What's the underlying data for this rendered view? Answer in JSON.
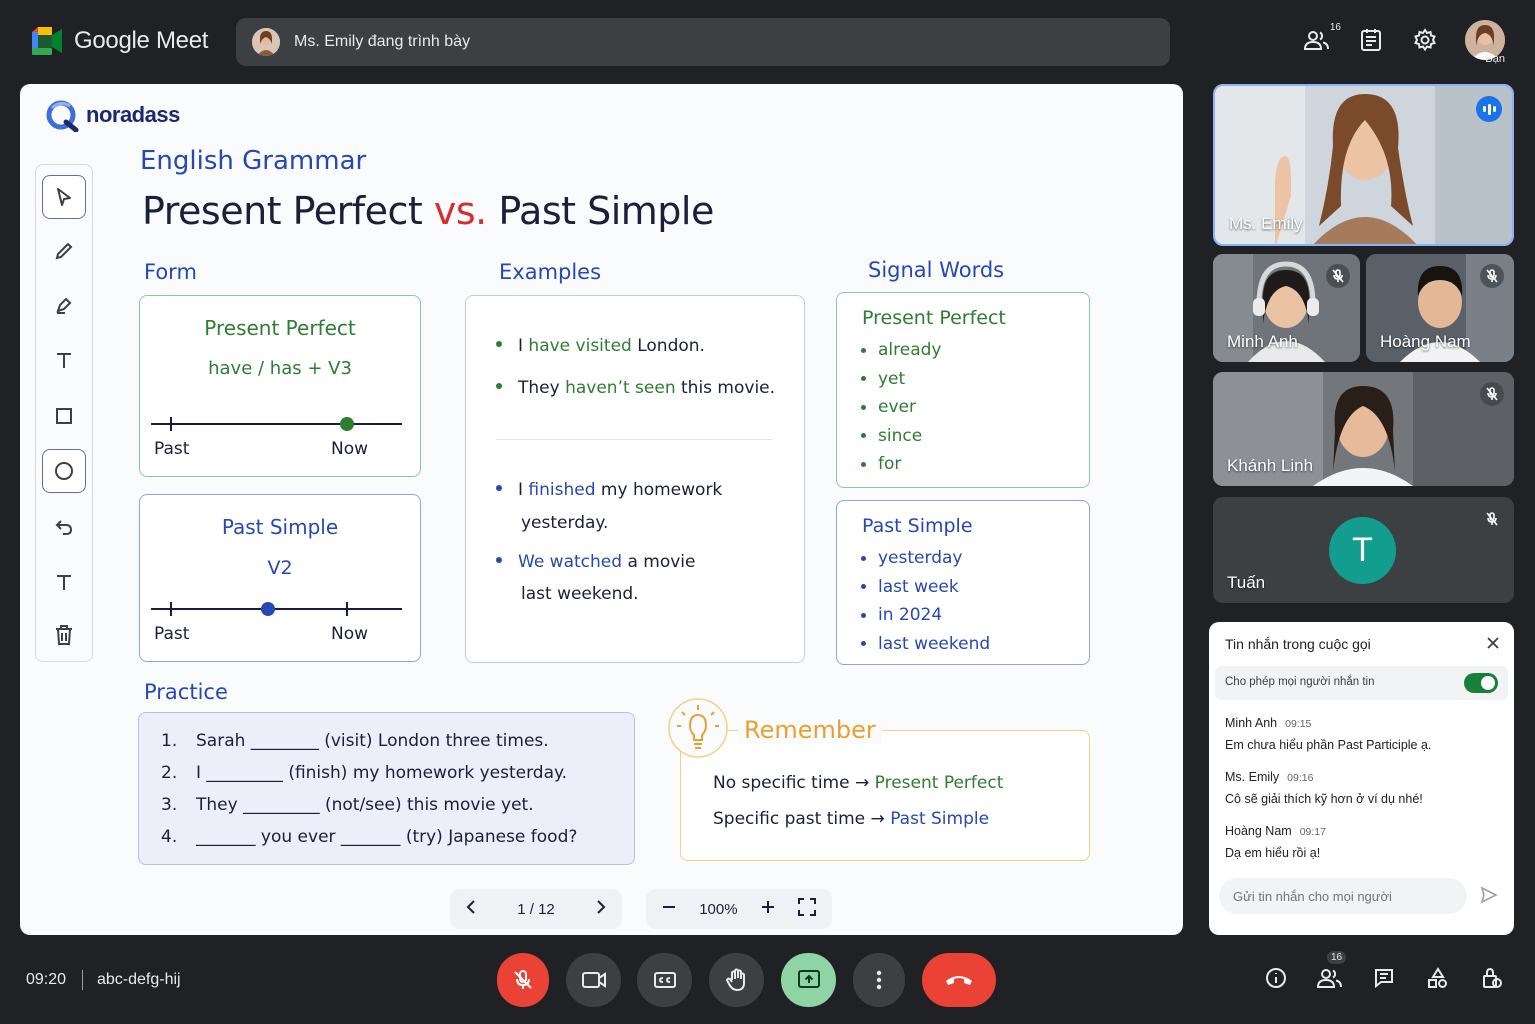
{
  "app": {
    "name": "Google Meet",
    "presenting": "Ms. Emily đang trình bày",
    "participant_count": "16",
    "me_label": "Bạn"
  },
  "slide": {
    "brand": "noradass",
    "subtitle": "English Grammar",
    "title_a": "Present Perfect",
    "title_vs": "vs.",
    "title_b": "Past Simple",
    "form": {
      "heading": "Form",
      "pp_title": "Present Perfect",
      "pp_formula": "have / has + V3",
      "ps_title": "Past Simple",
      "ps_formula": "V2",
      "past": "Past",
      "now": "Now"
    },
    "examples": {
      "heading": "Examples",
      "pp": [
        {
          "a": "I ",
          "b": "have visited",
          "c": " London."
        },
        {
          "a": "They ",
          "b": "haven’t seen",
          "c": " this movie."
        }
      ],
      "ps": [
        {
          "a": "I ",
          "b": "finished",
          "c": " my homework",
          "d": "yesterday."
        },
        {
          "a": "",
          "b": "We watched",
          "c": " a movie",
          "d": "last weekend."
        }
      ]
    },
    "signal": {
      "heading": "Signal Words",
      "pp_title": "Present Perfect",
      "pp_words": [
        "already",
        "yet",
        "ever",
        "since",
        "for"
      ],
      "ps_title": "Past Simple",
      "ps_words": [
        "yesterday",
        "last week",
        "in 2024",
        "last weekend"
      ]
    },
    "practice": {
      "heading": "Practice",
      "items": [
        {
          "num": "1.",
          "text": "Sarah ________ (visit) London three times."
        },
        {
          "num": "2.",
          "text": "I _________ (finish) my homework yesterday."
        },
        {
          "num": "3.",
          "text": "They _________ (not/see) this movie yet."
        },
        {
          "num": "4.",
          "text": "_______ you ever _______ (try) Japanese food?"
        }
      ]
    },
    "remember": {
      "title": "Remember",
      "row1_a": "No specific time",
      "row1_b": "Present Perfect",
      "row2_a": "Specific past time",
      "row2_b": "Past Simple"
    },
    "pager": {
      "page": "1 / 12"
    },
    "zoom": "100%"
  },
  "participants": [
    {
      "name": "Ms. Emily",
      "speaking": true
    },
    {
      "name": "Minh Anh",
      "muted": true
    },
    {
      "name": "Hoàng Nam",
      "muted": true
    },
    {
      "name": "Khánh Linh",
      "muted": true
    },
    {
      "name": "Tuấn",
      "muted": true,
      "initial": "T"
    }
  ],
  "chat": {
    "title": "Tin nhắn trong cuộc gọi",
    "allow_label": "Cho phép mọi người nhắn tin",
    "messages": [
      {
        "who": "Minh Anh",
        "time": "09:15",
        "text": "Em chưa hiểu phần Past Participle ạ."
      },
      {
        "who": "Ms. Emily",
        "time": "09:16",
        "text": "Cô sẽ giải thích kỹ hơn ở ví dụ nhé!"
      },
      {
        "who": "Hoàng Nam",
        "time": "09:17",
        "text": "Dạ em hiểu rồi ạ!"
      }
    ],
    "placeholder": "Gửi tin nhắn cho mọi người"
  },
  "bottom": {
    "time": "09:20",
    "code": "abc-defg-hij",
    "people_badge": "16"
  },
  "colors": {
    "accent": "#1a73e8",
    "end_call": "#ea4335",
    "present": "#8ed4a4",
    "green_text": "#2e7d32",
    "blue_text": "#2748b3"
  }
}
